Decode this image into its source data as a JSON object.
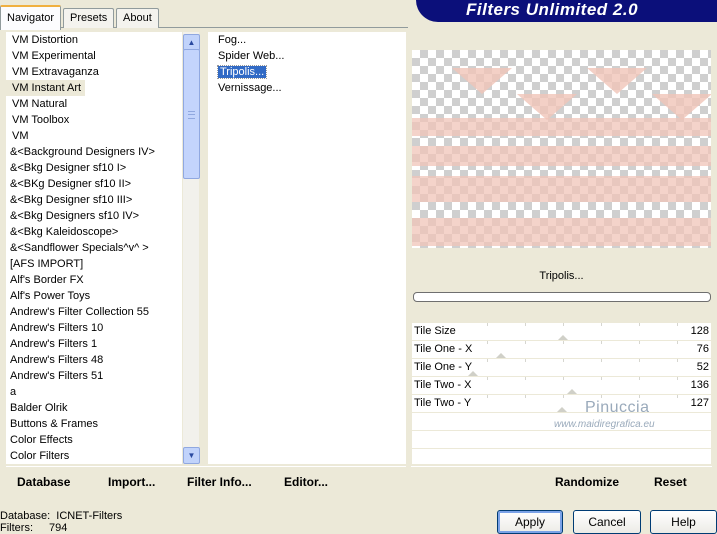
{
  "tabs": [
    "Navigator",
    "Presets",
    "About"
  ],
  "banner_title": "Filters Unlimited 2.0",
  "categories": [
    "VM Distortion",
    "VM Experimental",
    "VM Extravaganza",
    "VM Instant Art",
    "VM Natural",
    "VM Toolbox",
    "VM",
    "&<Background Designers IV>",
    "&<Bkg Designer sf10 I>",
    "&<BKg Designer sf10 II>",
    "&<Bkg Designer sf10 III>",
    "&<Bkg Designers sf10 IV>",
    "&<Bkg Kaleidoscope>",
    "&<Sandflower Specials^v^ >",
    "[AFS IMPORT]",
    "Alf's Border FX",
    "Alf's Power Toys",
    "Andrew's Filter Collection 55",
    "Andrew's Filters 10",
    "Andrew's Filters 1",
    "Andrew's Filters 48",
    "Andrew's Filters 51",
    "a",
    "Balder Olrik",
    "Buttons & Frames",
    "Color Effects",
    "Color Filters"
  ],
  "filters": [
    "Fog...",
    "Spider Web...",
    "Tripolis...",
    "Vernissage..."
  ],
  "left_buttons": {
    "database": "Database",
    "import": "Import...",
    "filter_info": "Filter Info...",
    "editor": "Editor..."
  },
  "current_filter": "Tripolis...",
  "sliders": [
    {
      "label": "Tile Size",
      "value": "128",
      "thumb_frac": 0.502
    },
    {
      "label": "Tile One - X",
      "value": "76",
      "thumb_frac": 0.298
    },
    {
      "label": "Tile One - Y",
      "value": "52",
      "thumb_frac": 0.204
    },
    {
      "label": "Tile Two - X",
      "value": "136",
      "thumb_frac": 0.533
    },
    {
      "label": "Tile Two - Y",
      "value": "127",
      "thumb_frac": 0.498
    }
  ],
  "right_buttons": {
    "randomize": "Randomize",
    "reset": "Reset"
  },
  "status": {
    "database_label": "Database:",
    "database_value": "ICNET-Filters",
    "filters_label": "Filters:",
    "filters_value": "794"
  },
  "dialog_buttons": {
    "apply": "Apply",
    "cancel": "Cancel",
    "help": "Help"
  },
  "watermark": {
    "line1": "Pinuccia",
    "line2": "www.maidiregrafica.eu"
  },
  "colors": {
    "banner": "#0b0f7a",
    "selection": "#316ac5"
  }
}
